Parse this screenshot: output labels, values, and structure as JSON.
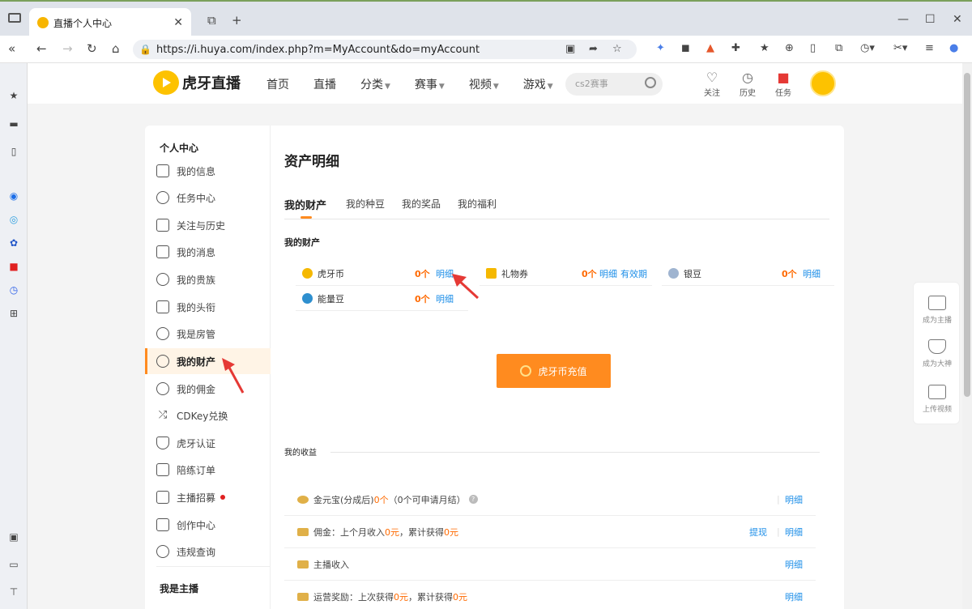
{
  "browser": {
    "tab_title": "直播个人中心",
    "url": "https://i.huya.com/index.php?m=MyAccount&do=myAccount"
  },
  "site": {
    "logo_text": "虎牙直播",
    "nav": [
      {
        "label": "首页",
        "has_caret": false
      },
      {
        "label": "直播",
        "has_caret": false
      },
      {
        "label": "分类",
        "has_caret": true
      },
      {
        "label": "赛事",
        "has_caret": true
      },
      {
        "label": "视频",
        "has_caret": true
      },
      {
        "label": "游戏",
        "has_caret": true
      }
    ],
    "search_placeholder": "cs2赛事",
    "header_icons": [
      {
        "label": "关注",
        "icon": "heart-icon"
      },
      {
        "label": "历史",
        "icon": "clock-icon"
      },
      {
        "label": "任务",
        "icon": "gift-icon"
      }
    ]
  },
  "menu": {
    "section1": "个人中心",
    "items": [
      {
        "label": "我的信息"
      },
      {
        "label": "任务中心"
      },
      {
        "label": "关注与历史"
      },
      {
        "label": "我的消息"
      },
      {
        "label": "我的贵族"
      },
      {
        "label": "我的头衔"
      },
      {
        "label": "我是房管"
      },
      {
        "label": "我的财产"
      },
      {
        "label": "我的佣金"
      },
      {
        "label": "CDKey兑换"
      },
      {
        "label": "虎牙认证"
      },
      {
        "label": "陪练订单"
      },
      {
        "label": "主播招募"
      },
      {
        "label": "创作中心"
      },
      {
        "label": "违规查询"
      }
    ],
    "section2": "我是主播",
    "active_index": 7
  },
  "main": {
    "title": "资产明细",
    "tabs": [
      "我的财产",
      "我的种豆",
      "我的奖品",
      "我的福利"
    ],
    "active_tab": 0,
    "assets_title": "我的财产",
    "assets": [
      {
        "name": "虎牙币",
        "amount": "0个",
        "link": "明细",
        "extra": ""
      },
      {
        "name": "礼物券",
        "amount": "0个",
        "link": "明细",
        "extra": "有效期"
      },
      {
        "name": "银豆",
        "amount": "0个",
        "link": "明细",
        "extra": ""
      },
      {
        "name": "能量豆",
        "amount": "0个",
        "link": "明细",
        "extra": ""
      }
    ],
    "recharge_button": "虎牙币充值",
    "income_title": "我的收益",
    "income": [
      {
        "prefix": "金元宝(分成后) ",
        "v1": "0个",
        "mid": "（0个可申请月结）",
        "v2": "",
        "suffix": "",
        "help": true,
        "action": "",
        "detail": "明细"
      },
      {
        "prefix": "佣金：上个月收入 ",
        "v1": "0元",
        "mid": "，累计获得 ",
        "v2": "0元",
        "suffix": "",
        "help": false,
        "action": "提现",
        "detail": "明细"
      },
      {
        "prefix": "主播收入",
        "v1": "",
        "mid": "",
        "v2": "",
        "suffix": "",
        "help": false,
        "action": "",
        "detail": "明细"
      },
      {
        "prefix": "运营奖励：上次获得 ",
        "v1": "0元",
        "mid": "，累计获得 ",
        "v2": "0元",
        "suffix": "",
        "help": false,
        "action": "",
        "detail": "明细"
      }
    ]
  },
  "right_panel": [
    {
      "label": "成为主播"
    },
    {
      "label": "成为大神"
    },
    {
      "label": "上传视频"
    }
  ],
  "colors": {
    "accent": "#ff8b1f",
    "link": "#1c8ee8",
    "amount": "#ff6a00",
    "annotation": "#e53935"
  }
}
